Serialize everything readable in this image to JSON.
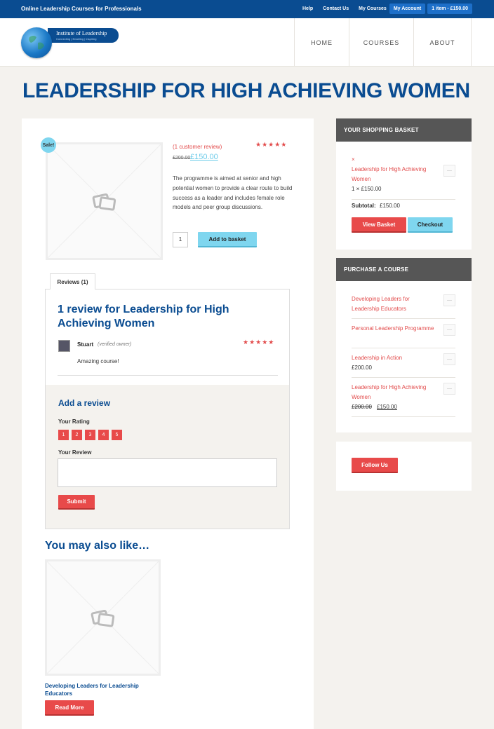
{
  "topbar": {
    "tagline": "Online Leadership Courses for Professionals",
    "links": [
      "Help",
      "Contact Us",
      "My Courses"
    ],
    "my_account": "My Account",
    "cart": "1 item - £150.00"
  },
  "logo": {
    "title": "Institute of Leadership",
    "subtitle": "Connecting | Enabling | Inspiring"
  },
  "nav": [
    "HOME",
    "COURSES",
    "ABOUT"
  ],
  "page_title": "LEADERSHIP FOR HIGH ACHIEVING WOMEN",
  "product": {
    "sale_badge": "Sale!",
    "review_link": "(1 customer review)",
    "stars": "★★★★★",
    "rating": 5,
    "price_old": "£200.00",
    "price_new": "£150.00",
    "description": "The programme is aimed at senior and high potential women to provide a clear route to build success as a leader and includes female role models and peer group discussions.",
    "quantity": "1",
    "add_to_basket": "Add to basket"
  },
  "tabs": {
    "reviews": "Reviews (1)"
  },
  "reviews": {
    "heading": "1 review for Leadership for High Achieving Women",
    "author": "Stuart",
    "verified": "(verified owner)",
    "stars": "★★★★★",
    "text": "Amazing course!"
  },
  "add_review": {
    "heading": "Add a review",
    "rating_label": "Your Rating",
    "rating_options": [
      "1",
      "2",
      "3",
      "4",
      "5"
    ],
    "review_label": "Your Review",
    "submit": "Submit"
  },
  "related": {
    "heading": "You may also like…",
    "item_title": "Developing Leaders for Leadership Educators",
    "read_more": "Read More"
  },
  "basket": {
    "heading": "YOUR SHOPPING BASKET",
    "remove": "×",
    "item_name": "Leadership for High Achieving Women",
    "item_qty": "1 × £150.00",
    "subtotal_label": "Subtotal:",
    "subtotal_value": "£150.00",
    "view_basket": "View Basket",
    "checkout": "Checkout"
  },
  "purchase": {
    "heading": "PURCHASE A COURSE",
    "items": [
      {
        "name": "Developing Leaders for Leadership Educators",
        "price": "",
        "old_price": ""
      },
      {
        "name": "Personal Leadership Programme",
        "price": "",
        "old_price": ""
      },
      {
        "name": "Leadership in Action",
        "price": "£200.00",
        "old_price": ""
      },
      {
        "name": "Leadership for High Achieving Women",
        "price": "£150.00",
        "old_price": "£200.00"
      }
    ]
  },
  "follow": {
    "label": "Follow Us"
  },
  "icons": {
    "placeholder_image": "image-placeholder-icon",
    "add_square": "add-square-icon"
  }
}
